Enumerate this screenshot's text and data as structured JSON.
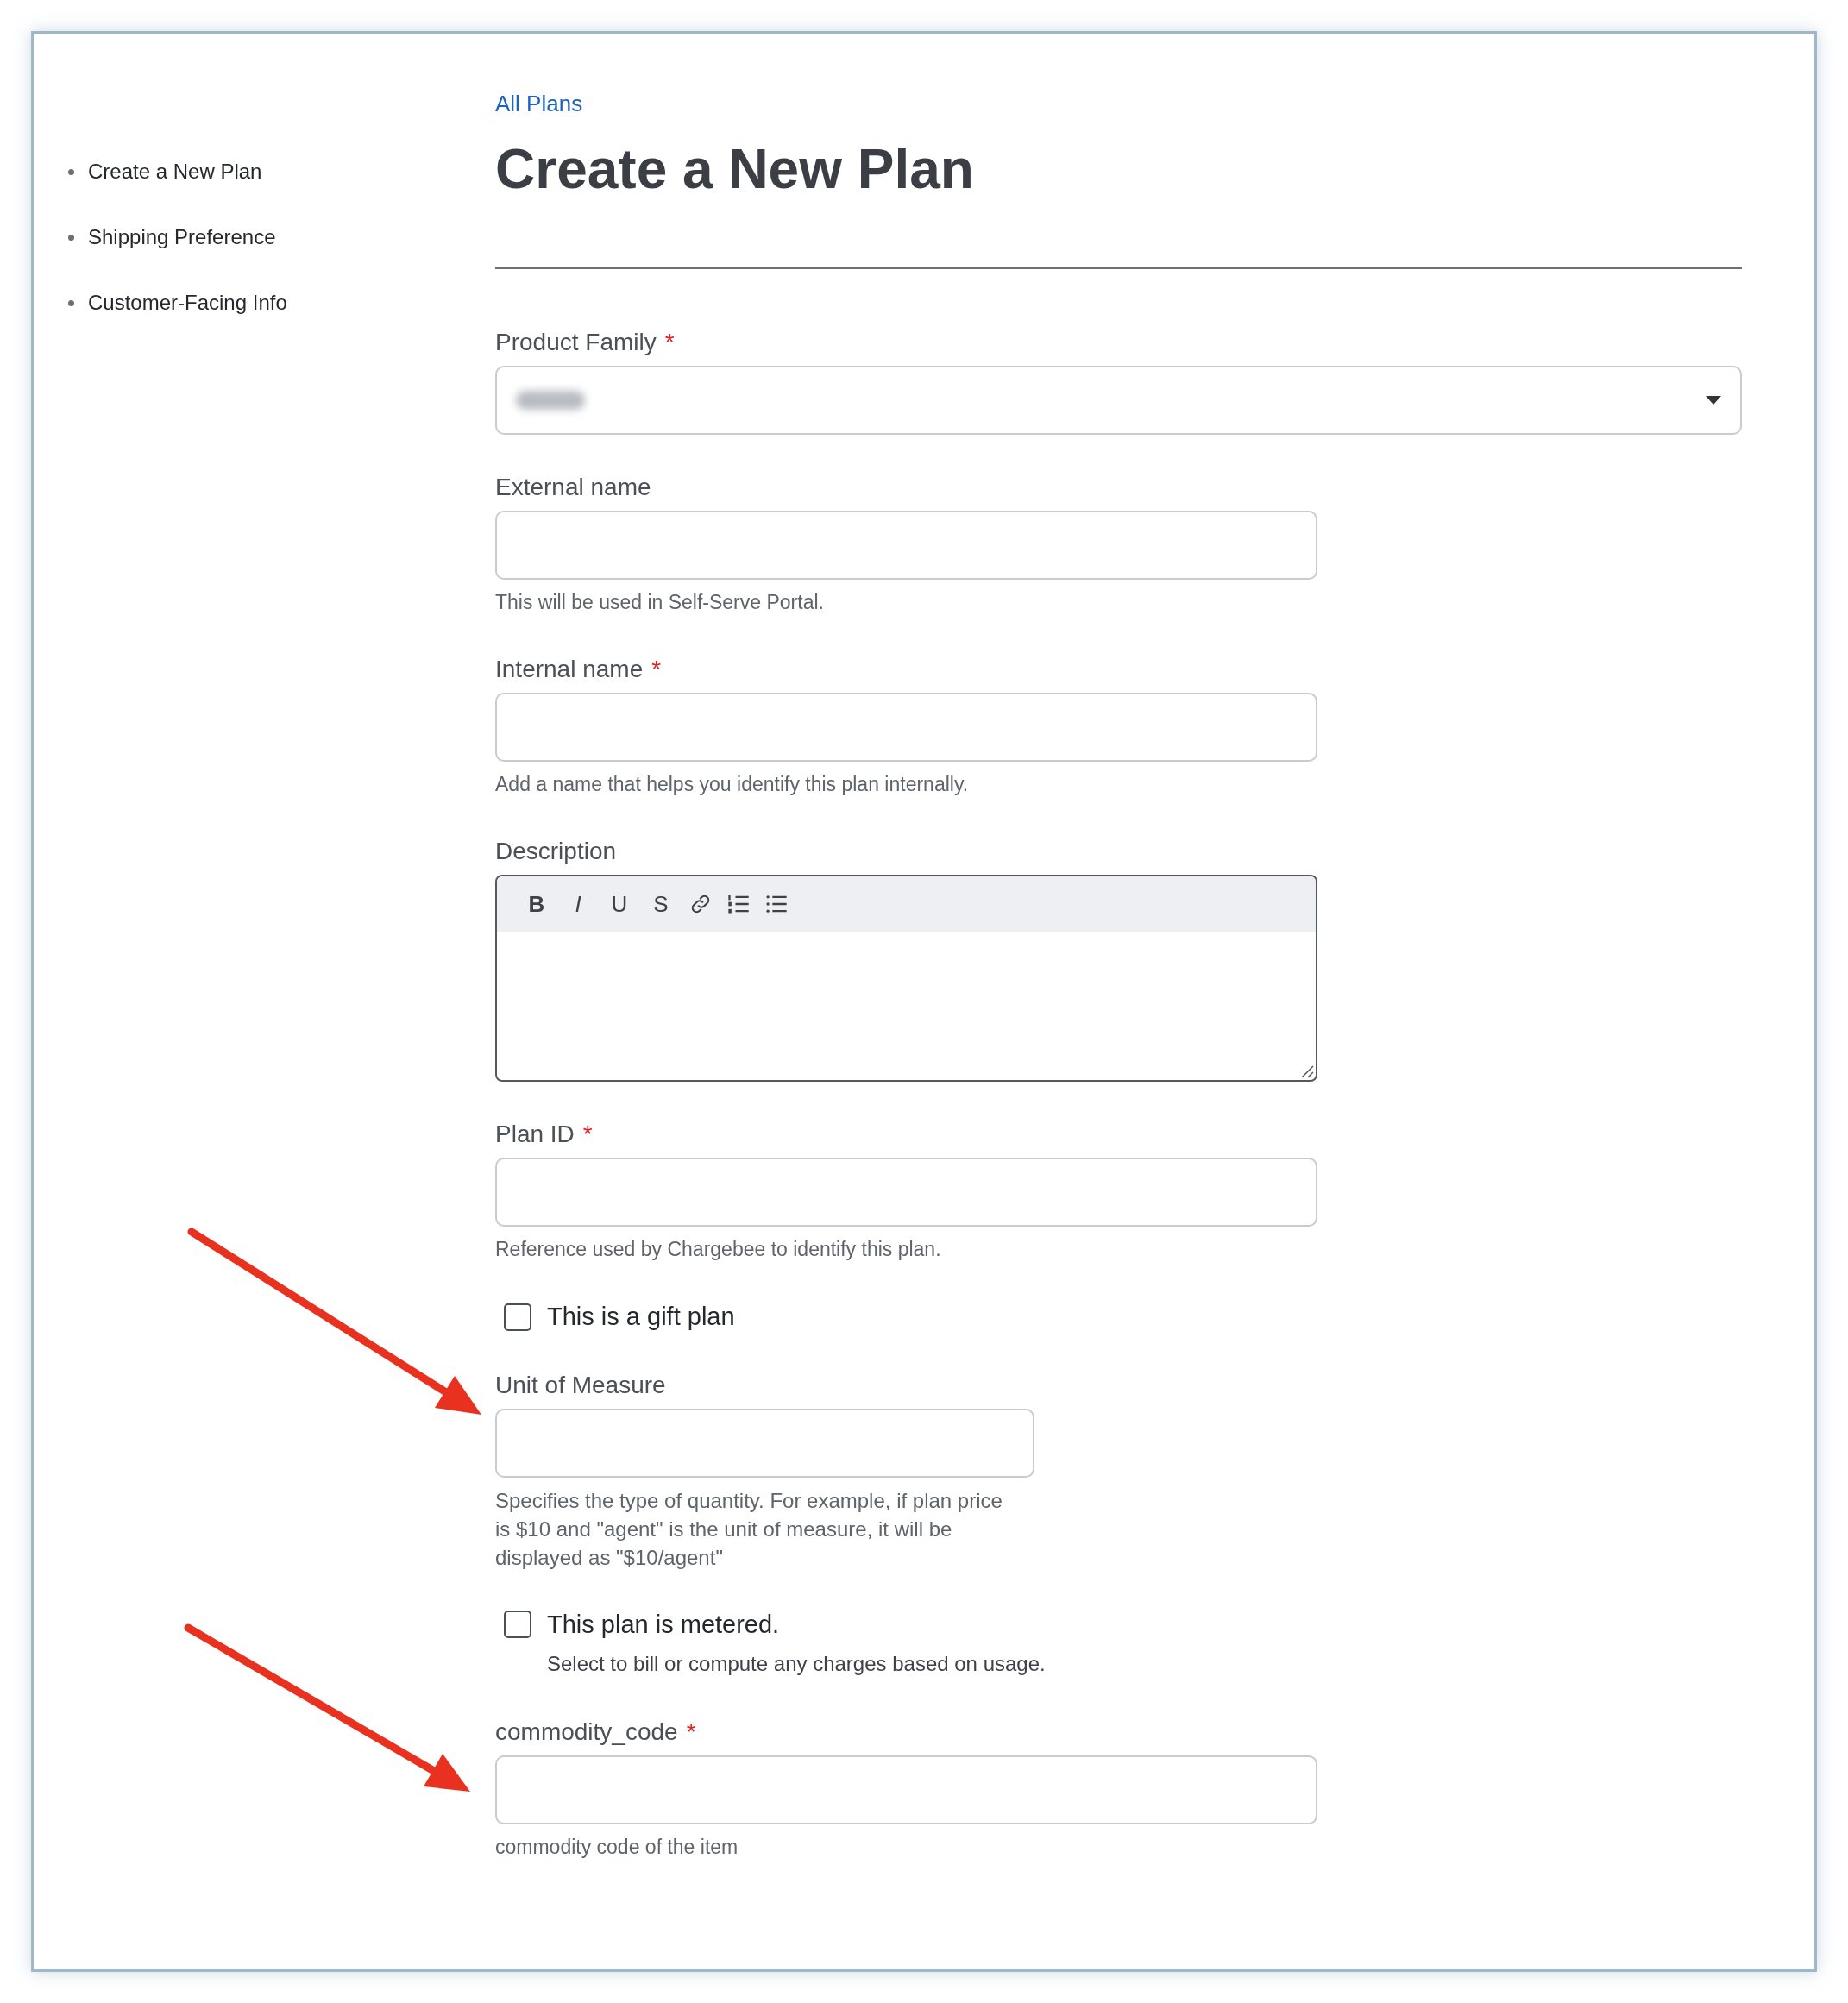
{
  "sidebar": {
    "items": [
      {
        "label": "Create a New Plan"
      },
      {
        "label": "Shipping Preference"
      },
      {
        "label": "Customer-Facing Info"
      }
    ]
  },
  "breadcrumb": "All Plans",
  "title": "Create a New Plan",
  "fields": [
    {
      "kind": "select",
      "label": "Product Family",
      "required_mark": "*",
      "redacted": true
    },
    {
      "kind": "text",
      "label": "External name",
      "help": "This will be used in Self-Serve Portal."
    },
    {
      "kind": "text",
      "label": "Internal name",
      "required_mark": "*",
      "help": "Add a name that helps you identify this plan internally."
    },
    {
      "kind": "richtext",
      "label": "Description",
      "toolbar": [
        {
          "kind": "bold",
          "label": "B"
        },
        {
          "kind": "italic",
          "label": "I"
        },
        {
          "kind": "underline",
          "label": "U"
        },
        {
          "kind": "strike",
          "label": "S"
        },
        {
          "kind": "link"
        },
        {
          "kind": "ordered-list"
        },
        {
          "kind": "bullet-list"
        }
      ]
    },
    {
      "kind": "text",
      "label": "Plan ID",
      "required_mark": "*",
      "help": "Reference used by Chargebee to identify this plan."
    },
    {
      "kind": "checkbox",
      "label": "This is a gift plan",
      "checked": false
    },
    {
      "kind": "short-text",
      "label": "Unit of Measure",
      "help": "Specifies the type of quantity. For example, if plan price is $10 and \"agent\" is the unit of measure, it will be displayed as \"$10/agent\""
    },
    {
      "kind": "checkbox",
      "label": "This plan is metered.",
      "checked": false,
      "help": "Select to bill or compute any charges based on usage."
    },
    {
      "kind": "text",
      "label": "commodity_code",
      "required_mark": "*",
      "help": "commodity code of the item"
    }
  ]
}
